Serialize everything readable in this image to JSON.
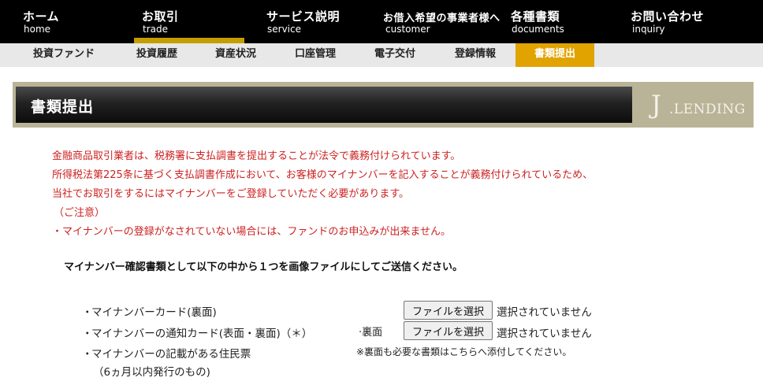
{
  "nav": {
    "items": [
      {
        "jp": "ホーム",
        "en": "home"
      },
      {
        "jp": "お取引",
        "en": "trade"
      },
      {
        "jp": "サービス説明",
        "en": "service"
      },
      {
        "jp": "お借入希望の事業者様へ",
        "en": "customer"
      },
      {
        "jp": "各種書類",
        "en": "documents"
      },
      {
        "jp": "お問い合わせ",
        "en": "inquiry"
      }
    ],
    "active": "trade"
  },
  "subnav": {
    "items": [
      "投資ファンド",
      "投資履歴",
      "資産状況",
      "口座管理",
      "電子交付",
      "登録情報",
      "書類提出"
    ],
    "active": "書類提出"
  },
  "title": {
    "text": "書類提出",
    "logo_initial": "J",
    "logo_rest": ".LENDING"
  },
  "notice": {
    "lines": [
      "金融商品取引業者は、税務署に支払調書を提出することが法令で義務付けられています。",
      "所得税法第225条に基づく支払調書作成において、お客様のマイナンバーを記入することが義務付けられているため、",
      "当社でお取引をするにはマイナンバーをご登録していただく必要があります。",
      "（ご注意）",
      "・マイナンバーの登録がなされていない場合には、ファンドのお申込みが出来ません。"
    ]
  },
  "instruction": "マイナンバー確認書類として以下の中から１つを画像ファイルにしてご送信ください。",
  "options": {
    "bullet": "・",
    "items": [
      "マイナンバーカード(裏面)",
      "マイナンバーの通知カード(表面・裏面)（＊）",
      "マイナンバーの記載がある住民票",
      "（6ヵ月以内発行のもの)"
    ]
  },
  "upload": {
    "back_label": "·裏面",
    "button_label": "ファイルを選択",
    "status": "選択されていません",
    "note": "※裏面も必要な書類はこちらへ添付してください。"
  },
  "colors": {
    "nav_bg": "#000000",
    "accent": "#e0a300",
    "notice_text": "#cc2222",
    "title_frame": "#b9b497"
  }
}
